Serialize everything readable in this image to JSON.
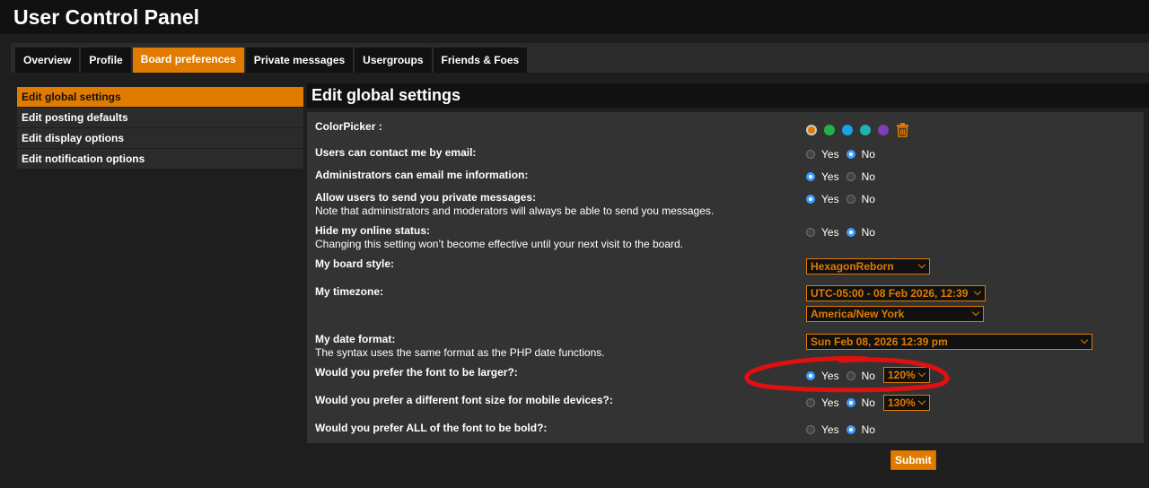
{
  "header": {
    "title": "User Control Panel"
  },
  "tabs": [
    {
      "label": "Overview",
      "active": false
    },
    {
      "label": "Profile",
      "active": false
    },
    {
      "label": "Board preferences",
      "active": true
    },
    {
      "label": "Private messages",
      "active": false
    },
    {
      "label": "Usergroups",
      "active": false
    },
    {
      "label": "Friends & Foes",
      "active": false
    }
  ],
  "sidebar": {
    "items": [
      {
        "label": "Edit global settings",
        "active": true
      },
      {
        "label": "Edit posting defaults",
        "active": false
      },
      {
        "label": "Edit display options",
        "active": false
      },
      {
        "label": "Edit notification options",
        "active": false
      }
    ]
  },
  "panel": {
    "title": "Edit global settings",
    "colorpicker": {
      "label": "ColorPicker :",
      "colors": [
        "#e07b00",
        "#22b14c",
        "#1aa3e8",
        "#1fb3b3",
        "#7b3fb5"
      ],
      "selected_index": 0,
      "delete_icon": "trash-icon"
    },
    "yes_label": "Yes",
    "no_label": "No",
    "settings": {
      "contact_email": {
        "label": "Users can contact me by email:",
        "value": "No"
      },
      "admin_email": {
        "label": "Administrators can email me information:",
        "value": "Yes"
      },
      "private_messages": {
        "label": "Allow users to send you private messages:",
        "desc": "Note that administrators and moderators will always be able to send you messages.",
        "value": "Yes"
      },
      "hide_online": {
        "label": "Hide my online status:",
        "desc": "Changing this setting won’t become effective until your next visit to the board.",
        "value": "No"
      },
      "board_style": {
        "label": "My board style:",
        "value": "HexagonReborn"
      },
      "timezone": {
        "label": "My timezone:",
        "offset_value": "UTC-05:00 - 08 Feb 2026, 12:39",
        "zone_value": "America/New York"
      },
      "date_format": {
        "label": "My date format:",
        "desc": "The syntax uses the same format as the PHP date functions.",
        "value": "Sun Feb 08, 2026 12:39 pm"
      },
      "font_larger": {
        "label": "Would you prefer the font to be larger?:",
        "value": "Yes",
        "size": "120%"
      },
      "font_mobile": {
        "label": "Would you prefer a different font size for mobile devices?:",
        "value": "No",
        "size": "130%"
      },
      "font_bold": {
        "label": "Would you prefer ALL of the font to be bold?:",
        "value": "No"
      }
    },
    "submit_label": "Submit"
  },
  "colors": {
    "accent": "#e07b00",
    "radio_on": "#3b9bff",
    "annotation": "#e01010"
  }
}
